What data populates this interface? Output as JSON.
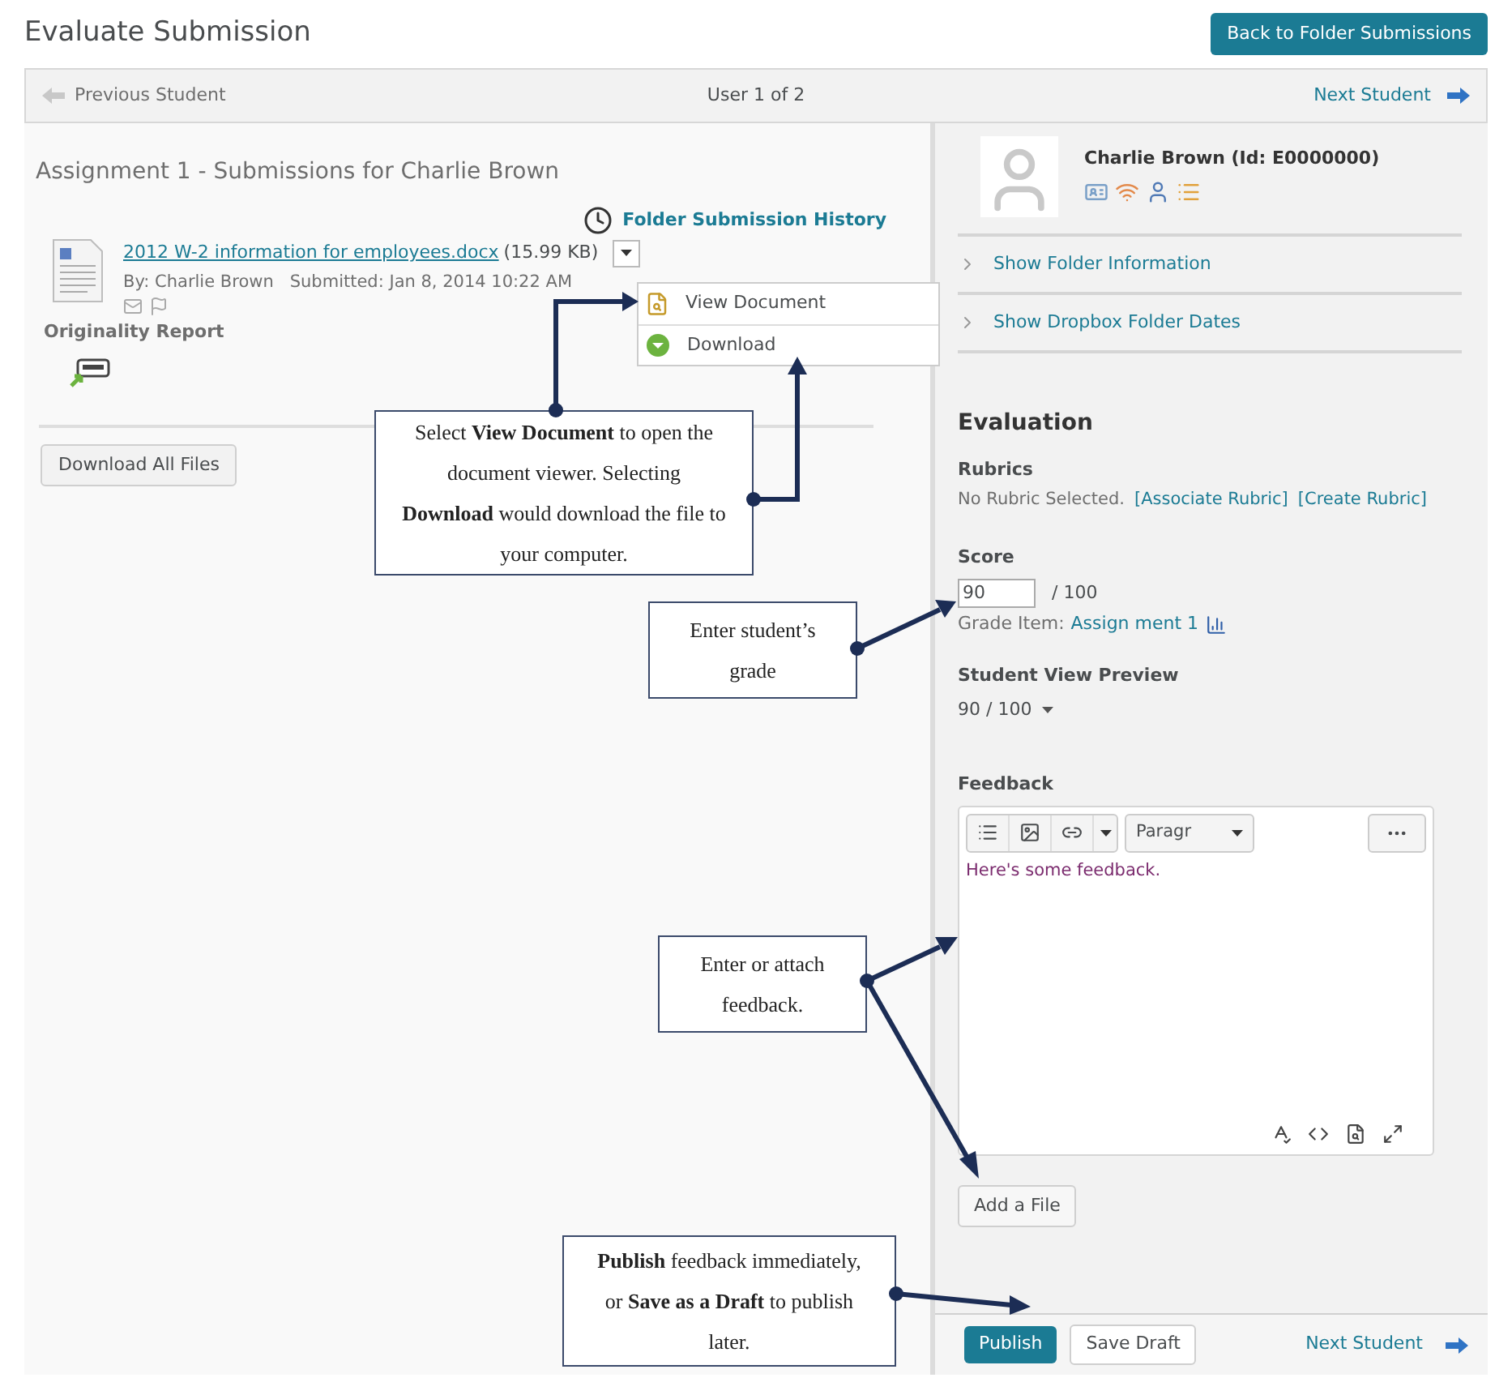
{
  "page": {
    "title": "Evaluate Submission",
    "back_button": "Back to Folder Submissions"
  },
  "nav": {
    "previous": "Previous Student",
    "position": "User 1 of 2",
    "next": "Next Student"
  },
  "submission": {
    "heading": "Assignment 1 - Submissions for Charlie Brown",
    "history_link": "Folder Submission History",
    "file_link": "2012 W-2 information for employees.docx",
    "file_size": "(15.99 KB)",
    "by": "By: Charlie Brown",
    "submitted": "Submitted: Jan 8, 2014 10:22 AM",
    "originality_label": "Originality Report",
    "download_all": "Download All Files"
  },
  "file_menu": [
    {
      "label": "View Document",
      "kind": "view"
    },
    {
      "label": "Download",
      "kind": "download"
    }
  ],
  "student": {
    "name": "Charlie Brown (Id: E0000000)"
  },
  "sections": [
    {
      "label": "Show Folder Information",
      "expanded": false
    },
    {
      "label": "Show Dropbox Folder Dates",
      "expanded": false
    }
  ],
  "evaluation": {
    "heading": "Evaluation",
    "rubrics_label": "Rubrics",
    "rubric_status": "No Rubric Selected.",
    "rubric_links": [
      "[Associate Rubric]",
      "[Create Rubric]"
    ],
    "score_label": "Score",
    "score": "90",
    "score_max": "/ 100",
    "grade_item_label": "Grade Item:",
    "grade_item": "Assign ment 1",
    "preview_label": "Student View Preview",
    "preview_value": "90 / 100",
    "feedback_label": "Feedback",
    "format": "Paragr",
    "feedback_text": "Here's some feedback.",
    "add_file": "Add a File"
  },
  "footer": {
    "publish": "Publish",
    "save_draft": "Save Draft",
    "next": "Next Student"
  },
  "callouts": [
    {
      "text": "Select **View Document** to open the document viewer. Selecting **Download** would download the file to your computer."
    },
    {
      "text": "Enter student’s grade"
    },
    {
      "text": "Enter or attach feedback."
    },
    {
      "text": "**Publish** feedback immediately, or **Save as a Draft** to publish later."
    }
  ]
}
